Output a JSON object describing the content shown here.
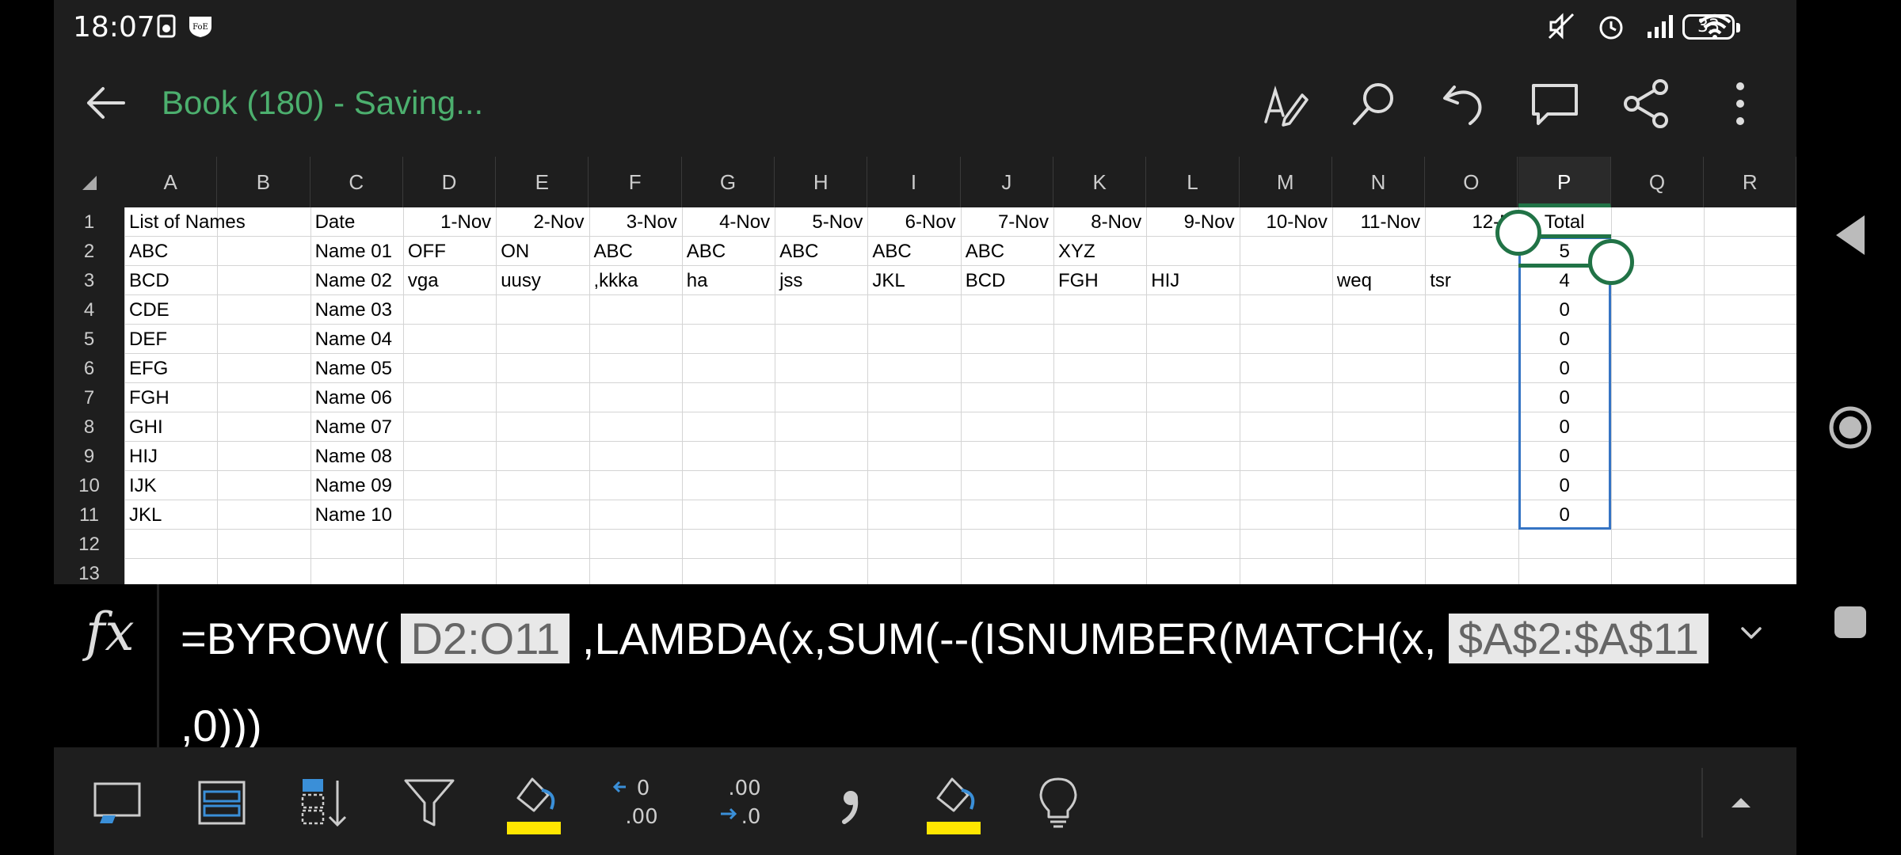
{
  "status": {
    "time": "18:07",
    "battery": "33"
  },
  "app": {
    "title": "Book (180) - Saving..."
  },
  "columns": [
    "A",
    "B",
    "C",
    "D",
    "E",
    "F",
    "G",
    "H",
    "I",
    "J",
    "K",
    "L",
    "M",
    "N",
    "O",
    "P",
    "Q",
    "R"
  ],
  "selected_column": "P",
  "rows": [
    {
      "num": "1",
      "cells": [
        "List of Names",
        "",
        "Date",
        "1-Nov",
        "2-Nov",
        "3-Nov",
        "4-Nov",
        "5-Nov",
        "6-Nov",
        "7-Nov",
        "8-Nov",
        "9-Nov",
        "10-Nov",
        "11-Nov",
        "12-N",
        "Total",
        "",
        ""
      ]
    },
    {
      "num": "2",
      "cells": [
        "ABC",
        "",
        "Name 01",
        "OFF",
        "ON",
        "ABC",
        "ABC",
        "ABC",
        "ABC",
        "ABC",
        "XYZ",
        "",
        "",
        "",
        "",
        "5",
        "",
        ""
      ]
    },
    {
      "num": "3",
      "cells": [
        "BCD",
        "",
        "Name 02",
        "vga",
        "uusy",
        ",kkka",
        "ha",
        "jss",
        "JKL",
        "BCD",
        "FGH",
        "HIJ",
        "",
        "weq",
        "tsr",
        "4",
        "",
        ""
      ]
    },
    {
      "num": "4",
      "cells": [
        "CDE",
        "",
        "Name 03",
        "",
        "",
        "",
        "",
        "",
        "",
        "",
        "",
        "",
        "",
        "",
        "",
        "0",
        "",
        ""
      ]
    },
    {
      "num": "5",
      "cells": [
        "DEF",
        "",
        "Name 04",
        "",
        "",
        "",
        "",
        "",
        "",
        "",
        "",
        "",
        "",
        "",
        "",
        "0",
        "",
        ""
      ]
    },
    {
      "num": "6",
      "cells": [
        "EFG",
        "",
        "Name 05",
        "",
        "",
        "",
        "",
        "",
        "",
        "",
        "",
        "",
        "",
        "",
        "",
        "0",
        "",
        ""
      ]
    },
    {
      "num": "7",
      "cells": [
        "FGH",
        "",
        "Name 06",
        "",
        "",
        "",
        "",
        "",
        "",
        "",
        "",
        "",
        "",
        "",
        "",
        "0",
        "",
        ""
      ]
    },
    {
      "num": "8",
      "cells": [
        "GHI",
        "",
        "Name 07",
        "",
        "",
        "",
        "",
        "",
        "",
        "",
        "",
        "",
        "",
        "",
        "",
        "0",
        "",
        ""
      ]
    },
    {
      "num": "9",
      "cells": [
        "HIJ",
        "",
        "Name 08",
        "",
        "",
        "",
        "",
        "",
        "",
        "",
        "",
        "",
        "",
        "",
        "",
        "0",
        "",
        ""
      ]
    },
    {
      "num": "10",
      "cells": [
        "IJK",
        "",
        "Name 09",
        "",
        "",
        "",
        "",
        "",
        "",
        "",
        "",
        "",
        "",
        "",
        "",
        "0",
        "",
        ""
      ]
    },
    {
      "num": "11",
      "cells": [
        "JKL",
        "",
        "Name 10",
        "",
        "",
        "",
        "",
        "",
        "",
        "",
        "",
        "",
        "",
        "",
        "",
        "0",
        "",
        ""
      ]
    },
    {
      "num": "12",
      "cells": [
        "",
        "",
        "",
        "",
        "",
        "",
        "",
        "",
        "",
        "",
        "",
        "",
        "",
        "",
        "",
        "",
        "",
        ""
      ]
    },
    {
      "num": "13",
      "cells": [
        "",
        "",
        "",
        "",
        "",
        "",
        "",
        "",
        "",
        "",
        "",
        "",
        "",
        "",
        "",
        "",
        "",
        ""
      ]
    }
  ],
  "formula": {
    "part1": "=BYROW(",
    "ref1": "D2:O11",
    "part2": ",LAMBDA(x,SUM(--(ISNUMBER(MATCH(x,",
    "ref2": "$A$2:$A$11",
    "part3": ",0)))",
    "part4": ")))"
  },
  "icons": {
    "back": "back-arrow-icon",
    "draw": "draw-pen-icon",
    "search": "search-icon",
    "undo": "undo-icon",
    "comment": "comment-icon",
    "share": "share-icon",
    "more": "more-vertical-icon"
  },
  "bottom_tools": [
    {
      "name": "select-cell-icon"
    },
    {
      "name": "format-table-icon"
    },
    {
      "name": "sort-icon"
    },
    {
      "name": "filter-icon"
    },
    {
      "name": "fill-color-icon"
    },
    {
      "name": "increase-decimal-icon"
    },
    {
      "name": "decrease-decimal-icon"
    },
    {
      "name": "comma-style-icon"
    },
    {
      "name": "highlight-color-icon"
    },
    {
      "name": "ideas-lightbulb-icon"
    }
  ],
  "colors": {
    "accent": "#217346",
    "title": "#4caf6e",
    "selection": "#3574c4",
    "highlight": "#ffe600"
  }
}
